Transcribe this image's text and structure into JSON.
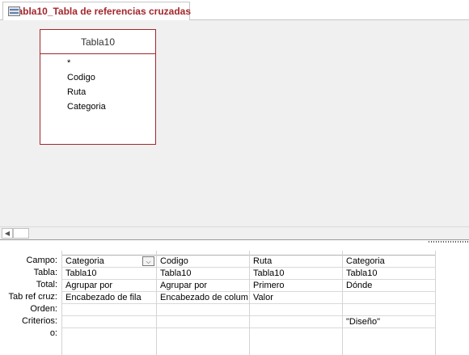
{
  "tab": {
    "title": "Tabla10_Tabla de referencias cruzadas",
    "icon": "crosstab-query-icon"
  },
  "table_box": {
    "title": "Tabla10",
    "fields": [
      "*",
      "Codigo",
      "Ruta",
      "Categoria"
    ]
  },
  "scrollbar": {
    "left_arrow": "◀"
  },
  "grid": {
    "row_labels": [
      "Campo:",
      "Tabla:",
      "Total:",
      "Tab ref cruz:",
      "Orden:",
      "Criterios:",
      "o:"
    ],
    "columns": [
      {
        "campo": "Categoria",
        "tabla": "Tabla10",
        "total": "Agrupar por",
        "tabref": "Encabezado de fila",
        "orden": "",
        "criterios": "",
        "o": ""
      },
      {
        "campo": "Codigo",
        "tabla": "Tabla10",
        "total": "Agrupar por",
        "tabref": "Encabezado de colum",
        "orden": "",
        "criterios": "",
        "o": ""
      },
      {
        "campo": "Ruta",
        "tabla": "Tabla10",
        "total": "Primero",
        "tabref": "Valor",
        "orden": "",
        "criterios": "",
        "o": ""
      },
      {
        "campo": "Categoria",
        "tabla": "Tabla10",
        "total": "Dónde",
        "tabref": "",
        "orden": "",
        "criterios": "\"Diseño\"",
        "o": ""
      }
    ],
    "dropdown_glyph": "⌵"
  }
}
